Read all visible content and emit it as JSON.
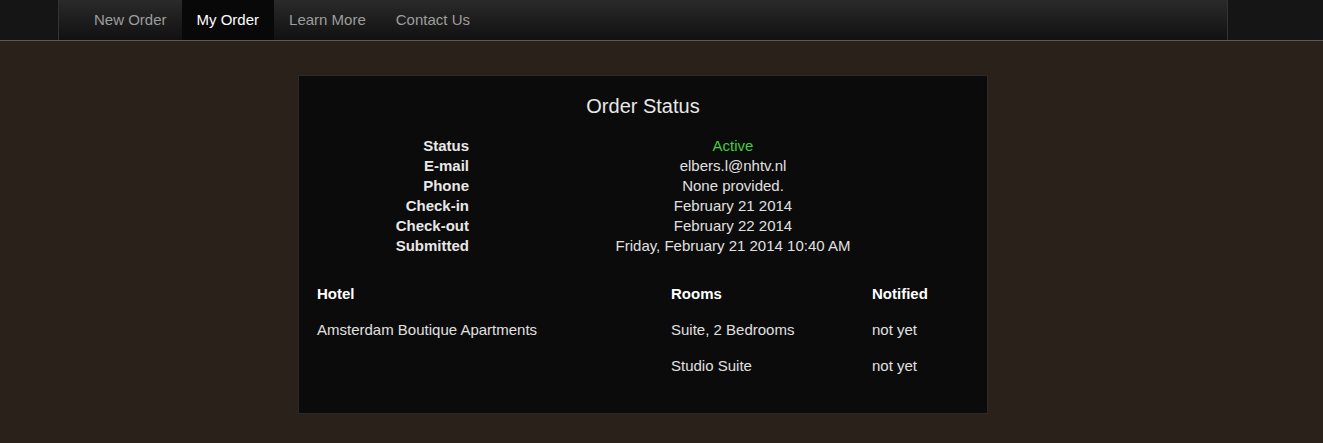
{
  "nav": {
    "items": [
      {
        "label": "New Order",
        "selected": false
      },
      {
        "label": "My Order",
        "selected": true
      },
      {
        "label": "Learn More",
        "selected": false
      },
      {
        "label": "Contact Us",
        "selected": false
      }
    ]
  },
  "panel": {
    "title": "Order Status",
    "fields": [
      {
        "label": "Status",
        "value": "Active",
        "color": "#3fcf3f"
      },
      {
        "label": "E-mail",
        "value": "elbers.l@nhtv.nl",
        "color": "#e0e0e0"
      },
      {
        "label": "Phone",
        "value": "None provided.",
        "color": "#e0e0e0"
      },
      {
        "label": "Check-in",
        "value": "February 21 2014",
        "color": "#e0e0e0"
      },
      {
        "label": "Check-out",
        "value": "February 22 2014",
        "color": "#e0e0e0"
      },
      {
        "label": "Submitted",
        "value": "Friday, February 21 2014 10:40 AM",
        "color": "#e0e0e0"
      }
    ]
  },
  "table": {
    "columns": [
      "Hotel",
      "Rooms",
      "Notified"
    ],
    "rows": [
      {
        "hotel": "Amsterdam Boutique Apartments",
        "room": "Suite, 2 Bedrooms",
        "notified": "not yet"
      },
      {
        "hotel": "",
        "room": "Studio Suite",
        "notified": "not yet"
      }
    ]
  }
}
